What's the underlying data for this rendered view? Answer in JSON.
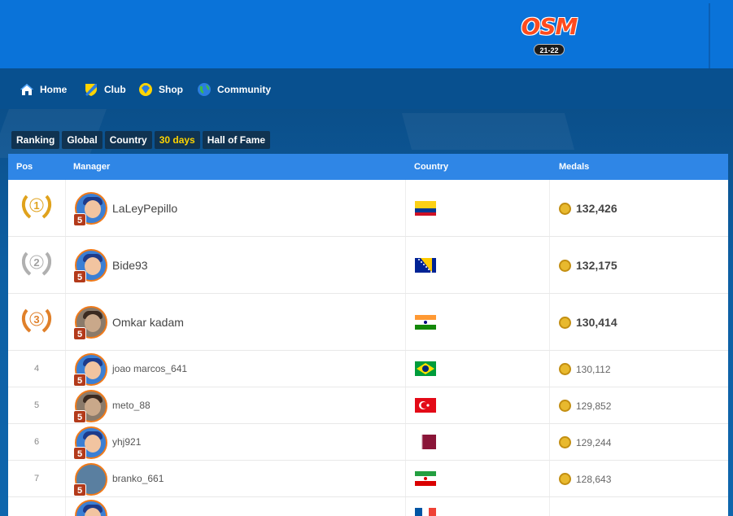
{
  "header": {
    "logo_text": "OSM",
    "season_text": "21-22"
  },
  "nav": {
    "items": [
      {
        "label": "Home",
        "icon": "home-icon"
      },
      {
        "label": "Club",
        "icon": "club-shield-icon"
      },
      {
        "label": "Shop",
        "icon": "shop-diamond-icon"
      },
      {
        "label": "Community",
        "icon": "globe-icon"
      }
    ]
  },
  "tabs": [
    {
      "label": "Ranking",
      "active": false
    },
    {
      "label": "Global",
      "active": false
    },
    {
      "label": "Country",
      "active": false
    },
    {
      "label": "30 days",
      "active": true
    },
    {
      "label": "Hall of Fame",
      "active": false
    }
  ],
  "table": {
    "columns": {
      "pos": "Pos",
      "manager": "Manager",
      "country": "Country",
      "medals": "Medals"
    },
    "rows": [
      {
        "pos": "1",
        "name": "LaLeyPepillo",
        "level": "5",
        "country_flag": "colombia-flag",
        "medals": "132,426"
      },
      {
        "pos": "2",
        "name": "Bide93",
        "level": "5",
        "country_flag": "bosnia-flag",
        "medals": "132,175"
      },
      {
        "pos": "3",
        "name": "Omkar kadam",
        "level": "5",
        "country_flag": "india-flag",
        "medals": "130,414"
      },
      {
        "pos": "4",
        "name": "joao marcos_641",
        "level": "5",
        "country_flag": "brazil-flag",
        "medals": "130,112"
      },
      {
        "pos": "5",
        "name": "meto_88",
        "level": "5",
        "country_flag": "turkey-flag",
        "medals": "129,852"
      },
      {
        "pos": "6",
        "name": "yhj921",
        "level": "5",
        "country_flag": "qatar-flag",
        "medals": "129,244"
      },
      {
        "pos": "7",
        "name": "branko_661",
        "level": "5",
        "country_flag": "iran-flag",
        "medals": "128,643"
      }
    ]
  },
  "colors": {
    "topbar": "#0a73d9",
    "navbar": "#08508f",
    "table_header": "#2f86e6",
    "active_tab": "#ffd400",
    "gold": "#e0a21c",
    "silver": "#b0b0b0",
    "bronze": "#e0802a"
  }
}
